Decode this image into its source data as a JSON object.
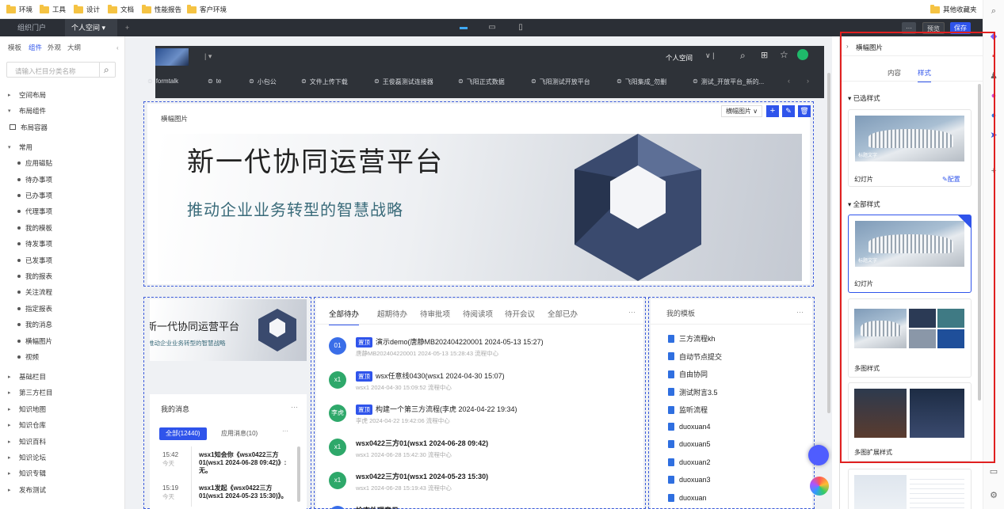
{
  "bookmarks": [
    "环境",
    "工具",
    "设计",
    "文档",
    "性能报告",
    "客户环境"
  ],
  "bookmarks_right": "其他收藏夹",
  "topbar": {
    "tabs": [
      "组织门户",
      "个人空间"
    ],
    "preview": "预览",
    "save": "保存",
    "more": "···"
  },
  "left": {
    "tabs": [
      "模板",
      "组件",
      "外观",
      "大纲"
    ],
    "search_placeholder": "请输入栏目分类名称",
    "tree": [
      "空间布局",
      "布局组件",
      "布局容器",
      "常用",
      "应用磁贴",
      "待办事项",
      "已办事项",
      "代理事项",
      "我的模板",
      "待发事项",
      "已发事项",
      "我的报表",
      "关注流程",
      "指定报表",
      "我的消息",
      "横幅图片",
      "视频",
      "基础栏目",
      "第三方栏目",
      "知识地图",
      "知识仓库",
      "知识百科",
      "知识论坛",
      "知识专辑",
      "发布测试"
    ]
  },
  "portal": {
    "space": "个人空间",
    "nav": [
      "formtalk",
      "te",
      "小包公",
      "文件上传下载",
      "王俊磊测试连接器",
      "飞阳正式数据",
      "飞阳测试开放平台",
      "飞阳集成_勿删",
      "测试_开放平台_新的..."
    ],
    "banner_widget": {
      "title": "横幅图片",
      "select": "横幅图片"
    },
    "banner_title": "新一代协同运营平台",
    "banner_sub": "推动企业业务转型的智慧战略",
    "small_banner_title": "新一代协同运营平台",
    "small_banner_sub": "推动企业业务转型的智慧战略",
    "messages": {
      "title": "我的消息",
      "more": "···",
      "tabs": [
        "全部(12440)",
        "应用消息(10)"
      ],
      "items": [
        {
          "time": "15:42",
          "day": "今天",
          "text": "wsx1知会你《wsx0422三方01(wsx1 2024-06-28 09:42)》: 无。"
        },
        {
          "time": "15:19",
          "day": "今天",
          "text": "wsx1发起《wsx0422三方01(wsx1 2024-05-23 15:30)》。"
        }
      ]
    },
    "todo": {
      "tabs": [
        "全部待办",
        "超期待办",
        "待审批项",
        "待阅读项",
        "待开会议",
        "全部已办"
      ],
      "more": "···",
      "items": [
        {
          "avatar": "01",
          "color": "#3a6ee8",
          "badge": "置顶",
          "title": "演示demo(唐静MB202404220001 2024-05-13 15:27)",
          "meta": "唐静MB202404220001   2024-05-13 15:28:43   流程中心"
        },
        {
          "avatar": "x1",
          "color": "#2ea86a",
          "badge": "置顶",
          "title": "wsx任意线0430(wsx1 2024-04-30 15:07)",
          "meta": "wsx1   2024-04-30 15:09:52   流程中心"
        },
        {
          "avatar": "李虎",
          "color": "#2ea86a",
          "badge": "置顶",
          "title": "构建一个第三方流程(李虎 2024-04-22 19:34)",
          "meta": "李虎   2024-04-22 19:42:06   流程中心"
        },
        {
          "avatar": "x1",
          "color": "#2ea86a",
          "badge": "",
          "title": "wsx0422三方01(wsx1 2024-06-28 09:42)",
          "meta": "wsx1   2024-06-28 15:42:30   流程中心"
        },
        {
          "avatar": "x1",
          "color": "#2ea86a",
          "badge": "",
          "title": "wsx0422三方01(wsx1 2024-05-23 15:30)",
          "meta": "wsx1   2024-06-28 15:19:43   流程中心"
        },
        {
          "avatar": "",
          "color": "#3a6ee8",
          "badge": "",
          "title": "检索外理意见",
          "meta": ""
        }
      ]
    },
    "templates": {
      "title": "我的模板",
      "more": "···",
      "items": [
        "三方流程kh",
        "自动节点提交",
        "自由协同",
        "测试附言3.5",
        "监听流程",
        "duoxuan4",
        "duoxuan5",
        "duoxuan2",
        "duoxuan3",
        "duoxuan"
      ]
    }
  },
  "props": {
    "title": "横幅图片",
    "tabs": [
      "内容",
      "样式"
    ],
    "selected_section": "已选样式",
    "all_section": "全部样式",
    "selected": {
      "name": "幻灯片",
      "config": "配置",
      "caption": "标题文字"
    },
    "styles": [
      {
        "name": "幻灯片",
        "caption": "标题文字"
      },
      {
        "name": "多图样式"
      },
      {
        "name": "多图扩展样式"
      }
    ]
  }
}
